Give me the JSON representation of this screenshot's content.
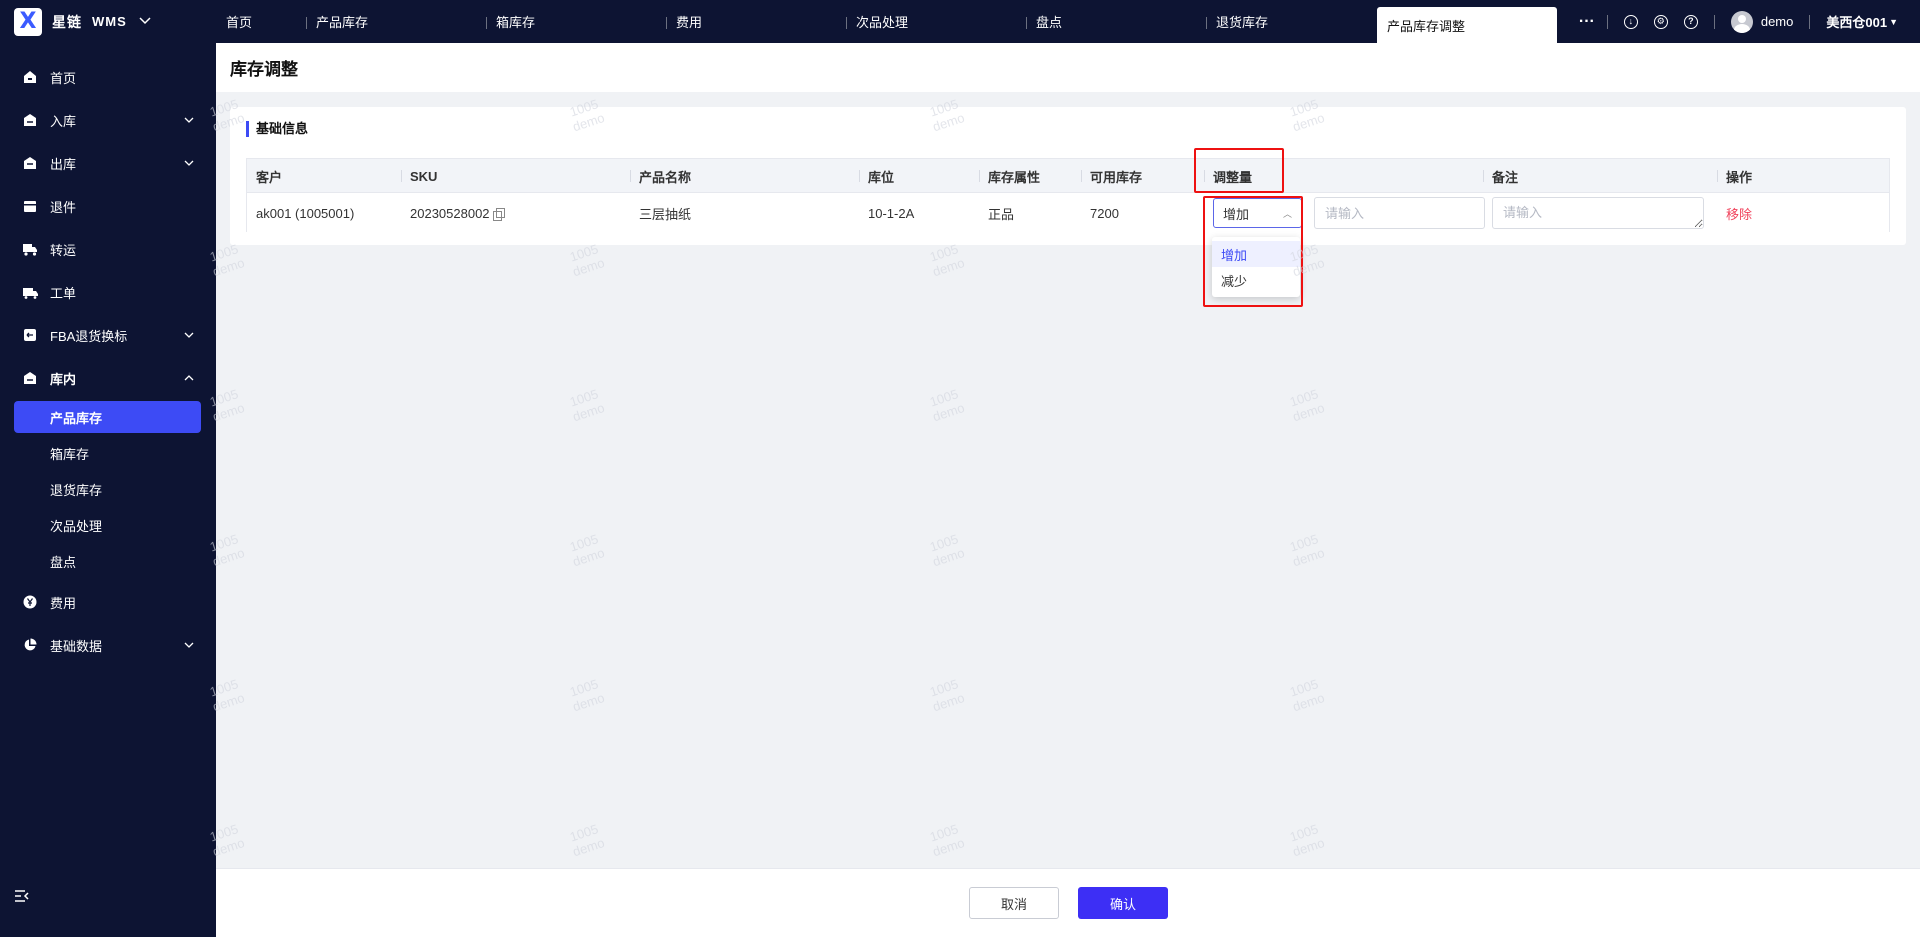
{
  "brand": {
    "name": "星链",
    "product": "WMS"
  },
  "top_tabs": [
    {
      "label": "首页"
    },
    {
      "label": "产品库存"
    },
    {
      "label": "箱库存"
    },
    {
      "label": "费用"
    },
    {
      "label": "次品处理"
    },
    {
      "label": "盘点"
    },
    {
      "label": "退货库存"
    },
    {
      "label": "产品库存调整",
      "active": true
    }
  ],
  "header": {
    "more": "···",
    "user": "demo",
    "warehouse": "美西仓001"
  },
  "sidebar": {
    "items": [
      {
        "label": "首页",
        "icon": "home-icon"
      },
      {
        "label": "入库",
        "icon": "inbound-icon",
        "expandable": true
      },
      {
        "label": "出库",
        "icon": "outbound-icon",
        "expandable": true
      },
      {
        "label": "退件",
        "icon": "return-icon"
      },
      {
        "label": "转运",
        "icon": "truck-icon"
      },
      {
        "label": "工单",
        "icon": "workorder-icon"
      },
      {
        "label": "FBA退货换标",
        "icon": "fba-icon",
        "expandable": true
      },
      {
        "label": "库内",
        "icon": "warehouse-icon",
        "expanded": true
      },
      {
        "label": "费用",
        "icon": "yen-icon"
      },
      {
        "label": "基础数据",
        "icon": "pie-chart-icon",
        "expandable": true
      }
    ],
    "sub_items": [
      {
        "label": "产品库存",
        "active": true
      },
      {
        "label": "箱库存"
      },
      {
        "label": "退货库存"
      },
      {
        "label": "次品处理"
      },
      {
        "label": "盘点"
      }
    ]
  },
  "page": {
    "title": "库存调整",
    "section_title": "基础信息"
  },
  "table": {
    "headers": [
      "客户",
      "SKU",
      "产品名称",
      "库位",
      "库存属性",
      "可用库存",
      "调整量",
      "备注",
      "操作"
    ],
    "row": {
      "customer": "ak001 (1005001)",
      "sku": "20230528002",
      "product_name": "三层抽纸",
      "location": "10-1-2A",
      "attribute": "正品",
      "available": "7200",
      "adjust_type": "增加",
      "adjust_qty_placeholder": "请输入",
      "remark_placeholder": "请输入",
      "action": "移除"
    }
  },
  "dropdown": {
    "options": [
      "增加",
      "减少"
    ],
    "selected": "增加"
  },
  "footer": {
    "cancel": "取消",
    "confirm": "确认"
  },
  "watermark": {
    "line1": "1005",
    "line2": "demo"
  },
  "colors": {
    "nav_bg": "#0d1433",
    "primary": "#3d4bf5",
    "danger": "#f0435c",
    "annotation": "#ee1111"
  }
}
